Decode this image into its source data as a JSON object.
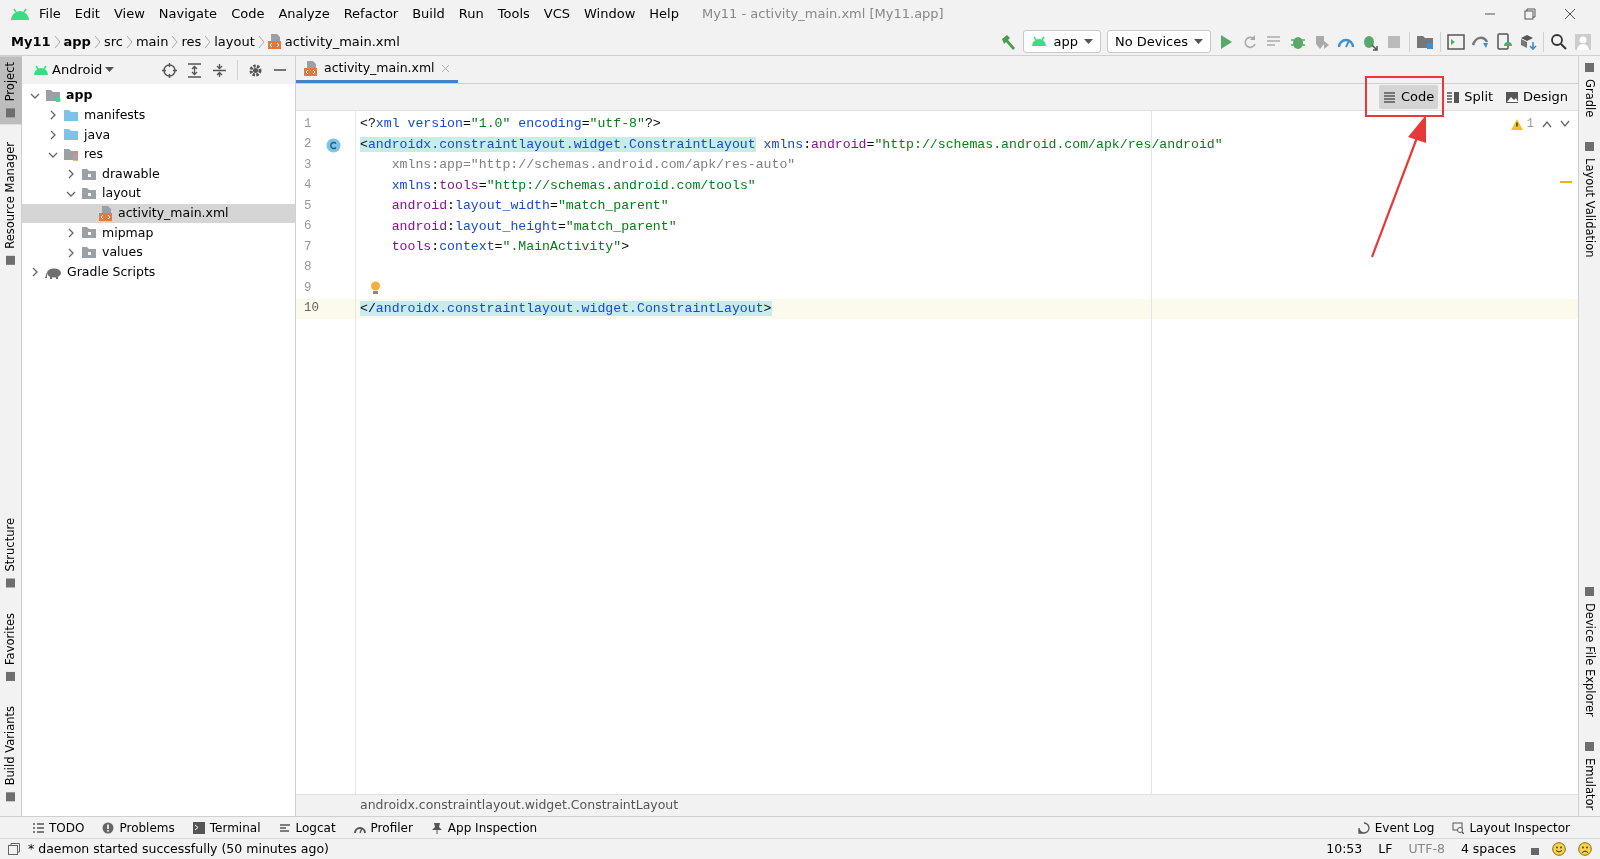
{
  "window": {
    "title": "My11 - activity_main.xml [My11.app]"
  },
  "menu": [
    {
      "label": "File"
    },
    {
      "label": "Edit"
    },
    {
      "label": "View"
    },
    {
      "label": "Navigate"
    },
    {
      "label": "Code"
    },
    {
      "label": "Analyze"
    },
    {
      "label": "Refactor"
    },
    {
      "label": "Build"
    },
    {
      "label": "Run"
    },
    {
      "label": "Tools"
    },
    {
      "label": "VCS"
    },
    {
      "label": "Window"
    },
    {
      "label": "Help"
    }
  ],
  "breadcrumbs": [
    {
      "label": "My11",
      "bold": true,
      "kind": "folder"
    },
    {
      "label": "app",
      "bold": true,
      "kind": "folder"
    },
    {
      "label": "src",
      "bold": false,
      "kind": "folder"
    },
    {
      "label": "main",
      "bold": false,
      "kind": "folder"
    },
    {
      "label": "res",
      "bold": false,
      "kind": "folder"
    },
    {
      "label": "layout",
      "bold": false,
      "kind": "folder"
    },
    {
      "label": "activity_main.xml",
      "bold": false,
      "kind": "xml"
    }
  ],
  "run_config": "app",
  "device": "No Devices",
  "left_tool_tabs": {
    "top": [
      {
        "label": "Project",
        "selected": true
      },
      {
        "label": "Resource Manager",
        "selected": false
      }
    ],
    "bottom": [
      {
        "label": "Structure",
        "selected": false
      },
      {
        "label": "Favorites",
        "selected": false
      },
      {
        "label": "Build Variants",
        "selected": false
      }
    ]
  },
  "right_tool_tabs": {
    "top": [
      {
        "label": "Gradle"
      },
      {
        "label": "Layout Validation"
      }
    ],
    "bottom": [
      {
        "label": "Device File Explorer"
      },
      {
        "label": "Emulator"
      }
    ]
  },
  "project_panel": {
    "view": "Android",
    "tree": [
      {
        "label": "app",
        "kind": "module",
        "expanded": true,
        "selected": false,
        "children": [
          {
            "label": "manifests",
            "kind": "source-folder",
            "expanded": false,
            "selected": false
          },
          {
            "label": "java",
            "kind": "source-folder",
            "expanded": false,
            "selected": false
          },
          {
            "label": "res",
            "kind": "res-folder",
            "expanded": true,
            "selected": false,
            "children": [
              {
                "label": "drawable",
                "kind": "folder",
                "expanded": false,
                "selected": false
              },
              {
                "label": "layout",
                "kind": "folder",
                "expanded": true,
                "selected": false,
                "children": [
                  {
                    "label": "activity_main.xml",
                    "kind": "xml",
                    "selected": true
                  }
                ]
              },
              {
                "label": "mipmap",
                "kind": "folder",
                "expanded": false,
                "selected": false
              },
              {
                "label": "values",
                "kind": "folder",
                "expanded": false,
                "selected": false
              }
            ]
          }
        ]
      },
      {
        "label": "Gradle Scripts",
        "kind": "gradle",
        "expanded": false,
        "selected": false
      }
    ]
  },
  "editor": {
    "tabs": [
      {
        "label": "activity_main.xml",
        "selected": true
      }
    ],
    "view_modes": [
      {
        "label": "Code",
        "kind": "code",
        "selected": true,
        "annotated": true
      },
      {
        "label": "Split",
        "kind": "split",
        "selected": false,
        "annotated": false
      },
      {
        "label": "Design",
        "kind": "design",
        "selected": false,
        "annotated": false
      }
    ],
    "warning_count": "1",
    "lines": [
      {
        "number": "1",
        "current": false,
        "tokens": [
          {
            "kind": "punct",
            "text": "<?"
          },
          {
            "kind": "name",
            "text": "xml version"
          },
          {
            "kind": "punct",
            "text": "="
          },
          {
            "kind": "value",
            "text": "\"1.0\""
          },
          {
            "kind": "name",
            "text": " encoding"
          },
          {
            "kind": "punct",
            "text": "="
          },
          {
            "kind": "value",
            "text": "\"utf-8\""
          },
          {
            "kind": "punct",
            "text": "?>"
          }
        ]
      },
      {
        "number": "2",
        "current": false,
        "class_marker": true,
        "tokens": [
          {
            "kind": "punct",
            "text": "<",
            "highlighted": true
          },
          {
            "kind": "name",
            "text": "androidx.constraintlayout.widget.ConstraintLayout",
            "highlighted": true
          },
          {
            "kind": "name",
            "text": " xmlns"
          },
          {
            "kind": "punct",
            "text": ":"
          },
          {
            "kind": "ns",
            "text": "android"
          },
          {
            "kind": "punct",
            "text": "="
          },
          {
            "kind": "value",
            "text": "\"http://schemas.android.com/apk/res/android\""
          }
        ]
      },
      {
        "number": "3",
        "current": false,
        "tokens": [
          {
            "kind": "unused",
            "text": "    xmlns:app=\"http://schemas.android.com/apk/res-auto\""
          }
        ]
      },
      {
        "number": "4",
        "current": false,
        "tokens": [
          {
            "kind": "name",
            "text": "    xmlns"
          },
          {
            "kind": "punct",
            "text": ":"
          },
          {
            "kind": "ns",
            "text": "tools"
          },
          {
            "kind": "punct",
            "text": "="
          },
          {
            "kind": "value",
            "text": "\"http://schemas.android.com/tools\""
          }
        ]
      },
      {
        "number": "5",
        "current": false,
        "tokens": [
          {
            "kind": "ns",
            "text": "    android"
          },
          {
            "kind": "punct",
            "text": ":"
          },
          {
            "kind": "name",
            "text": "layout_width"
          },
          {
            "kind": "punct",
            "text": "="
          },
          {
            "kind": "value",
            "text": "\"match_parent\""
          }
        ]
      },
      {
        "number": "6",
        "current": false,
        "tokens": [
          {
            "kind": "ns",
            "text": "    android"
          },
          {
            "kind": "punct",
            "text": ":"
          },
          {
            "kind": "name",
            "text": "layout_height"
          },
          {
            "kind": "punct",
            "text": "="
          },
          {
            "kind": "value",
            "text": "\"match_parent\""
          }
        ]
      },
      {
        "number": "7",
        "current": false,
        "tokens": [
          {
            "kind": "ns",
            "text": "    tools"
          },
          {
            "kind": "punct",
            "text": ":"
          },
          {
            "kind": "name",
            "text": "context"
          },
          {
            "kind": "punct",
            "text": "="
          },
          {
            "kind": "value",
            "text": "\".MainActivity\""
          },
          {
            "kind": "punct",
            "text": ">"
          }
        ]
      },
      {
        "number": "8",
        "current": false
      },
      {
        "number": "9",
        "current": false,
        "intention_bulb": true
      },
      {
        "number": "10",
        "current": true,
        "tokens": [
          {
            "kind": "punct",
            "text": "</",
            "highlighted": true
          },
          {
            "kind": "name",
            "text": "androidx.constraintlayout.widget.ConstraintLayout",
            "highlighted": true
          },
          {
            "kind": "punct",
            "text": ">",
            "highlighted": true
          }
        ]
      }
    ],
    "breadcrumb": "androidx.constraintlayout.widget.ConstraintLayout"
  },
  "bottom_tools": {
    "left": [
      {
        "label": "TODO",
        "kind": "list"
      },
      {
        "label": "Problems",
        "kind": "problems"
      },
      {
        "label": "Terminal",
        "kind": "terminal"
      },
      {
        "label": "Logcat",
        "kind": "logcat"
      },
      {
        "label": "Profiler",
        "kind": "gauge"
      },
      {
        "label": "App Inspection",
        "kind": "inspect"
      }
    ],
    "right": [
      {
        "label": "Event Log",
        "kind": "bubble"
      },
      {
        "label": "Layout Inspector",
        "kind": "layout"
      }
    ]
  },
  "status_bar": {
    "message": "* daemon started successfully (50 minutes ago)",
    "position": "10:53",
    "line_separator": "LF",
    "encoding": "UTF-8",
    "indent": "4 spaces"
  }
}
